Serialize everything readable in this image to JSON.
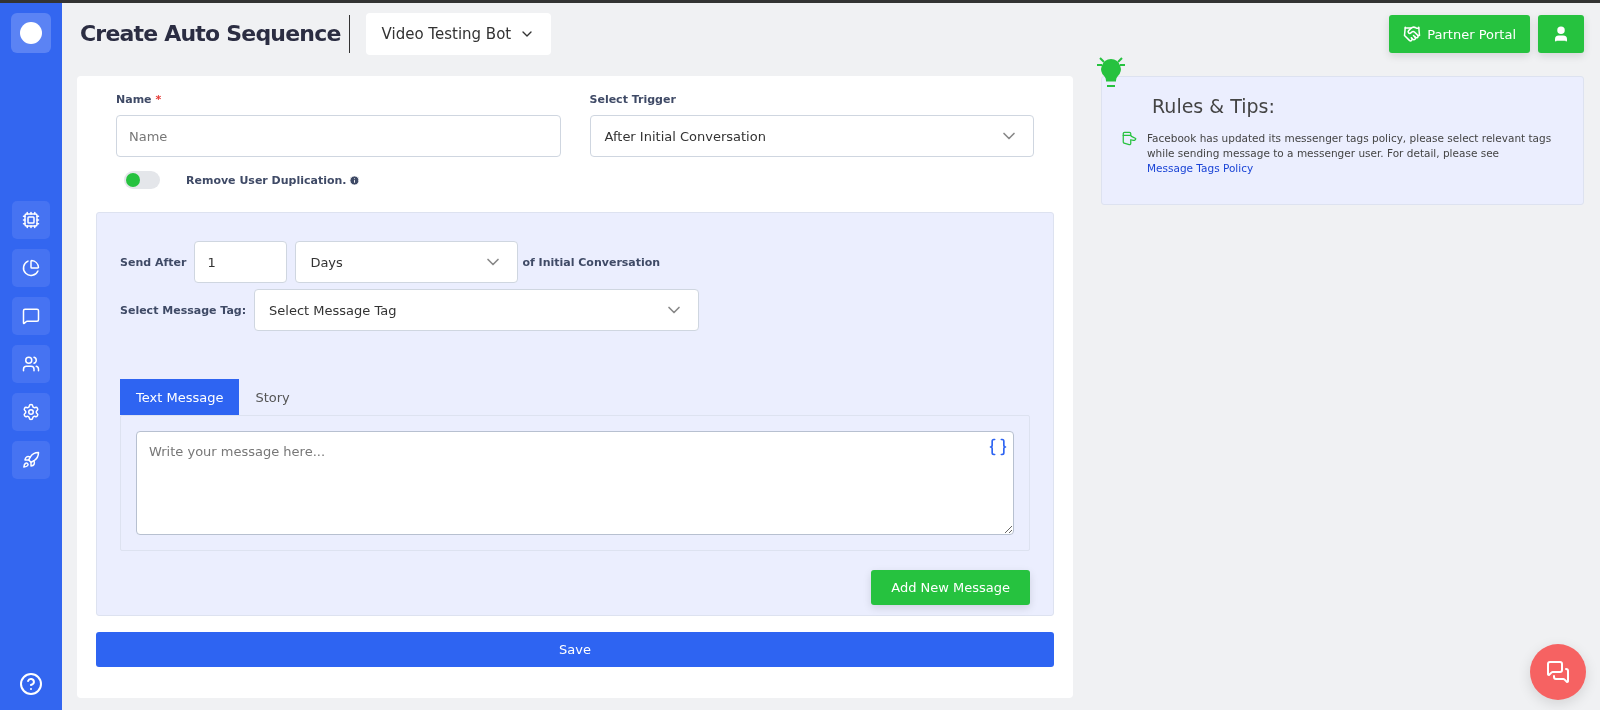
{
  "header": {
    "title": "Create Auto Sequence",
    "bot_selector": "Video Testing Bot",
    "partner_button": "Partner Portal"
  },
  "form": {
    "name": {
      "label": "Name",
      "required_mark": "*",
      "placeholder": "Name"
    },
    "trigger": {
      "label": "Select Trigger",
      "value": "After Initial Conversation"
    },
    "remove_duplication": {
      "label": "Remove User Duplication.",
      "on": false
    },
    "send_after": {
      "label": "Send After",
      "value": "1",
      "unit": "Days",
      "suffix": "of Initial Conversation"
    },
    "message_tag": {
      "label": "Select Message Tag:",
      "value": "Select Message Tag"
    },
    "tabs": [
      {
        "label": "Text Message",
        "selected": true
      },
      {
        "label": "Story",
        "selected": false
      }
    ],
    "message": {
      "placeholder": "Write your message here..."
    },
    "add_button": "Add New Message",
    "save_button": "Save"
  },
  "tips": {
    "title": "Rules & Tips:",
    "text": "Facebook has updated its messenger tags policy, please select relevant tags while sending message to a messenger user. For detail, please see",
    "link": "Message Tags Policy"
  }
}
